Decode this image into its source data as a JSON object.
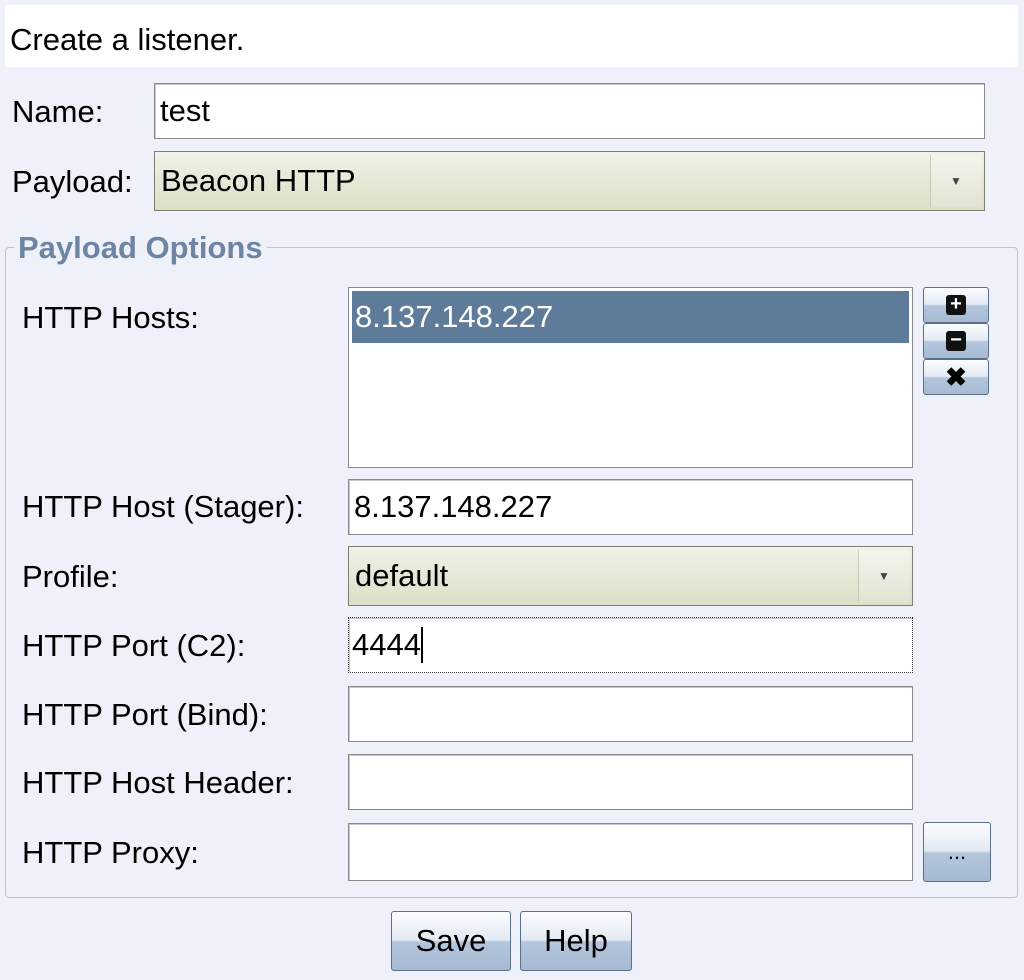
{
  "header": {
    "text": "Create a listener."
  },
  "name": {
    "label": "Name:",
    "value": "test"
  },
  "payload": {
    "label": "Payload:",
    "value": "Beacon HTTP"
  },
  "options": {
    "legend": "Payload Options",
    "hosts": {
      "label": "HTTP Hosts:",
      "items": [
        "8.137.148.227"
      ]
    },
    "stager": {
      "label": "HTTP Host (Stager):",
      "value": "8.137.148.227"
    },
    "profile": {
      "label": "Profile:",
      "value": "default"
    },
    "port_c2": {
      "label": "HTTP Port (C2):",
      "value": "4444"
    },
    "port_bind": {
      "label": "HTTP Port (Bind):",
      "value": ""
    },
    "host_header": {
      "label": "HTTP Host Header:",
      "value": ""
    },
    "proxy": {
      "label": "HTTP Proxy:",
      "value": "",
      "button": "..."
    }
  },
  "buttons": {
    "save": "Save",
    "help": "Help"
  }
}
